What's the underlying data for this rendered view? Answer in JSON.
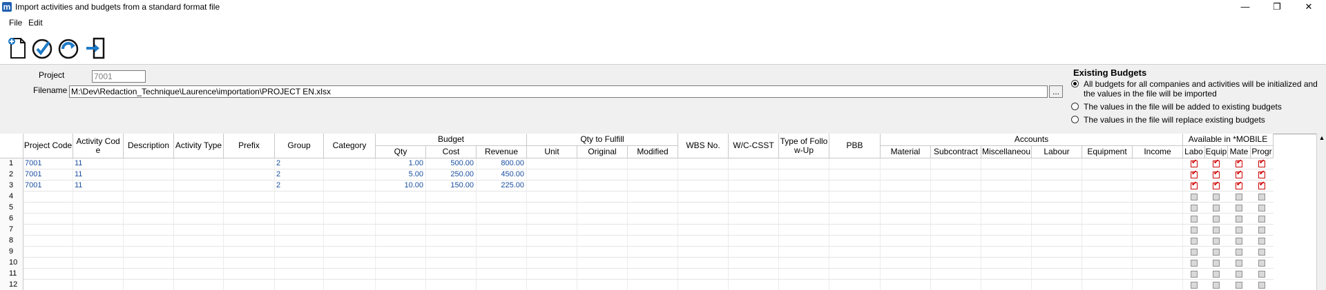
{
  "window": {
    "title": "Import activities and budgets from a standard format file",
    "icon_letter": "m",
    "controls": {
      "minimize": "—",
      "restore": "❐",
      "close": "✕"
    }
  },
  "menu": [
    "File",
    "Edit"
  ],
  "toolbar": [
    {
      "name": "new-document-icon"
    },
    {
      "name": "validate-check-icon"
    },
    {
      "name": "refresh-icon"
    },
    {
      "name": "exit-door-icon"
    }
  ],
  "form": {
    "project_label": "Project",
    "project_value": "7001",
    "filename_label": "Filename",
    "filename_value": "M:\\Dev\\Redaction_Technique\\Laurence\\importation\\PROJECT EN.xlsx",
    "browse_label": "..."
  },
  "existing_budgets": {
    "title": "Existing Budgets",
    "options": [
      {
        "label": "All budgets for all companies and activities will be initialized and",
        "label2": "the values in the file will be imported",
        "selected": true
      },
      {
        "label": "The values in the file will be added to existing budgets",
        "selected": false
      },
      {
        "label": "The values in the file will replace existing budgets",
        "selected": false
      }
    ]
  },
  "grid": {
    "group_headers": {
      "budget": "Budget",
      "qty_to_fulfill": "Qty to Fulfill",
      "accounts": "Accounts",
      "available_mobile": "Available in *MOBILE"
    },
    "columns": {
      "project_code": "Project Code",
      "activity_code_1": "Activity Cod",
      "activity_code_2": "e",
      "description": "Description",
      "activity_type": "Activity Type",
      "prefix": "Prefix",
      "group": "Group",
      "category": "Category",
      "qty": "Qty",
      "cost": "Cost",
      "revenue": "Revenue",
      "unit": "Unit",
      "original": "Original",
      "modified": "Modified",
      "wbs": "WBS No.",
      "wc_csst": "W/C-CSST",
      "type_followup_1": "Type of Follo",
      "type_followup_2": "w-Up",
      "pbb": "PBB",
      "material": "Material",
      "subcontract": "Subcontract",
      "miscellaneous": "Miscellaneou",
      "labour": "Labour",
      "equipment": "Equipment",
      "income": "Income",
      "m_labour": "Labo",
      "m_equip": "Equip",
      "m_mate": "Mate",
      "m_progr": "Progr"
    },
    "rows": [
      {
        "n": "1",
        "project": "7001",
        "activity": "11",
        "group": "2",
        "qty": "1.00",
        "cost": "500.00",
        "revenue": "800.00",
        "checks": [
          true,
          true,
          true,
          true
        ]
      },
      {
        "n": "2",
        "project": "7001",
        "activity": "11",
        "group": "2",
        "qty": "5.00",
        "cost": "250.00",
        "revenue": "450.00",
        "checks": [
          true,
          true,
          true,
          true
        ]
      },
      {
        "n": "3",
        "project": "7001",
        "activity": "11",
        "group": "2",
        "qty": "10.00",
        "cost": "150.00",
        "revenue": "225.00",
        "checks": [
          true,
          true,
          true,
          true
        ]
      },
      {
        "n": "4",
        "project": "",
        "activity": "",
        "group": "",
        "qty": "",
        "cost": "",
        "revenue": "",
        "checks": [
          false,
          false,
          false,
          false
        ]
      },
      {
        "n": "5",
        "project": "",
        "activity": "",
        "group": "",
        "qty": "",
        "cost": "",
        "revenue": "",
        "checks": [
          false,
          false,
          false,
          false
        ]
      },
      {
        "n": "6",
        "project": "",
        "activity": "",
        "group": "",
        "qty": "",
        "cost": "",
        "revenue": "",
        "checks": [
          false,
          false,
          false,
          false
        ]
      },
      {
        "n": "7",
        "project": "",
        "activity": "",
        "group": "",
        "qty": "",
        "cost": "",
        "revenue": "",
        "checks": [
          false,
          false,
          false,
          false
        ]
      },
      {
        "n": "8",
        "project": "",
        "activity": "",
        "group": "",
        "qty": "",
        "cost": "",
        "revenue": "",
        "checks": [
          false,
          false,
          false,
          false
        ]
      },
      {
        "n": "9",
        "project": "",
        "activity": "",
        "group": "",
        "qty": "",
        "cost": "",
        "revenue": "",
        "checks": [
          false,
          false,
          false,
          false
        ]
      },
      {
        "n": "10",
        "project": "",
        "activity": "",
        "group": "",
        "qty": "",
        "cost": "",
        "revenue": "",
        "checks": [
          false,
          false,
          false,
          false
        ]
      },
      {
        "n": "11",
        "project": "",
        "activity": "",
        "group": "",
        "qty": "",
        "cost": "",
        "revenue": "",
        "checks": [
          false,
          false,
          false,
          false
        ]
      },
      {
        "n": "12",
        "project": "",
        "activity": "",
        "group": "",
        "qty": "",
        "cost": "",
        "revenue": "",
        "checks": [
          false,
          false,
          false,
          false
        ]
      }
    ]
  },
  "colors": {
    "value_text": "#1a4fa0",
    "check_red": "#d00000"
  }
}
